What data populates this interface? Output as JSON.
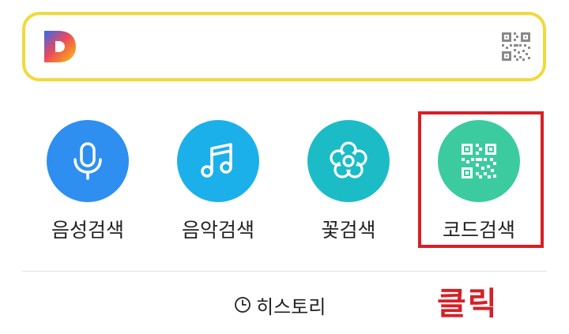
{
  "search": {
    "logo_letter": "D",
    "qr_icon": "qr-code-icon"
  },
  "buttons": [
    {
      "label": "음성검색",
      "icon": "microphone-icon",
      "color": "#2e8ff0"
    },
    {
      "label": "음악검색",
      "icon": "music-note-icon",
      "color": "#1cb0ea"
    },
    {
      "label": "꽃검색",
      "icon": "flower-icon",
      "color": "#1cbcc7"
    },
    {
      "label": "코드검색",
      "icon": "qr-code-icon",
      "color": "#3ccb9f"
    }
  ],
  "history": {
    "label": "히스토리",
    "icon": "clock-icon"
  },
  "annotation": {
    "text": "클릭",
    "color": "#d81f26"
  }
}
